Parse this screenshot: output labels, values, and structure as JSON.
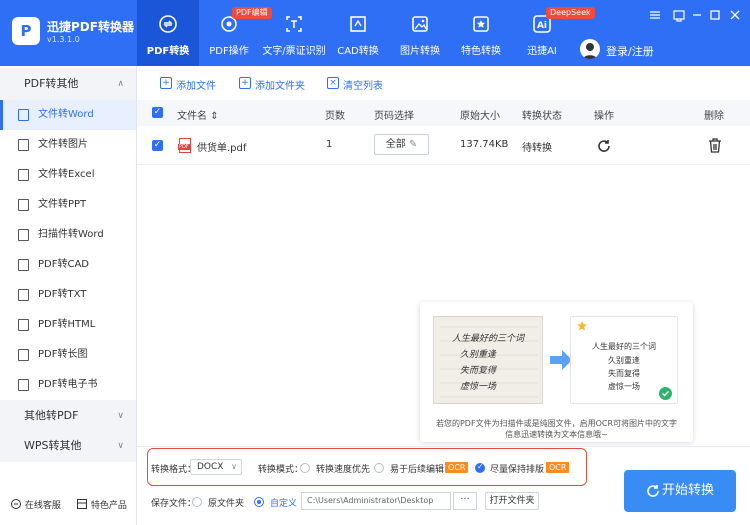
{
  "app": {
    "name": "迅捷PDF转换器",
    "version": "v1.3.1.0",
    "logo_letter": "P"
  },
  "nav": [
    {
      "label": "PDF转换",
      "icon": "pdf-convert-icon",
      "active": true
    },
    {
      "label": "PDF操作",
      "icon": "pdf-operate-icon",
      "badge": "PDF编辑"
    },
    {
      "label": "文字/票证识别",
      "icon": "text-recognition-icon"
    },
    {
      "label": "CAD转换",
      "icon": "cad-convert-icon"
    },
    {
      "label": "图片转换",
      "icon": "image-convert-icon"
    },
    {
      "label": "特色转换",
      "icon": "special-convert-icon"
    },
    {
      "label": "迅捷AI",
      "icon": "ai-icon",
      "icon_text": "Ai",
      "badge": "DeepSeek"
    }
  ],
  "user": {
    "login_label": "登录/注册"
  },
  "sidebar": {
    "group1": "PDF转其他",
    "items": [
      "文件转Word",
      "文件转图片",
      "文件转Excel",
      "文件转PPT",
      "扫描件转Word",
      "PDF转CAD",
      "PDF转TXT",
      "PDF转HTML",
      "PDF转长图",
      "PDF转电子书"
    ],
    "group2": "其他转PDF",
    "group3": "WPS转其他",
    "footer_service": "在线客服",
    "footer_products": "特色产品"
  },
  "toolbar": {
    "add_file": "添加文件",
    "add_folder": "添加文件夹",
    "clear_list": "清空列表"
  },
  "table": {
    "headers": {
      "name": "文件名",
      "pages": "页数",
      "page_select": "页码选择",
      "size": "原始大小",
      "status": "转换状态",
      "action": "操作",
      "delete": "删除"
    },
    "rows": [
      {
        "name": "供货单.pdf",
        "pages": "1",
        "page_select": "全部",
        "size": "137.74KB",
        "status": "待转换"
      }
    ]
  },
  "promo": {
    "handwriting": [
      "人生最好的三个词",
      "久别重逢",
      "失而复得",
      "虚惊一场"
    ],
    "card_lines": [
      "人生最好的三个词",
      "久别重逢",
      "失而复得",
      "虚惊一场"
    ],
    "description": "若您的PDF文件为扫描件或是纯图文件，启用OCR可将图片中的文字信息迅速转换为文本信息哦~"
  },
  "options": {
    "format_label": "转换格式：",
    "format_value": "DOCX",
    "mode_label": "转换模式：",
    "modes": [
      {
        "label": "转换速度优先",
        "selected": false
      },
      {
        "label": "易于后续编辑",
        "selected": false,
        "tag": "OCR"
      },
      {
        "label": "尽量保持排版",
        "selected": true,
        "tag": "OCR"
      }
    ],
    "save_label": "保存文件：",
    "save_original": "原文件夹",
    "save_custom": "自定义",
    "path": "C:\\Users\\Administrator\\Desktop",
    "browse": "···",
    "open_folder": "打开文件夹"
  },
  "start_button": "开始转换",
  "colors": {
    "primary": "#2f6ff5",
    "highlight_border": "#e94b3c",
    "ocr_tag": "#ff8a1d",
    "badge": "#f04a3a"
  }
}
